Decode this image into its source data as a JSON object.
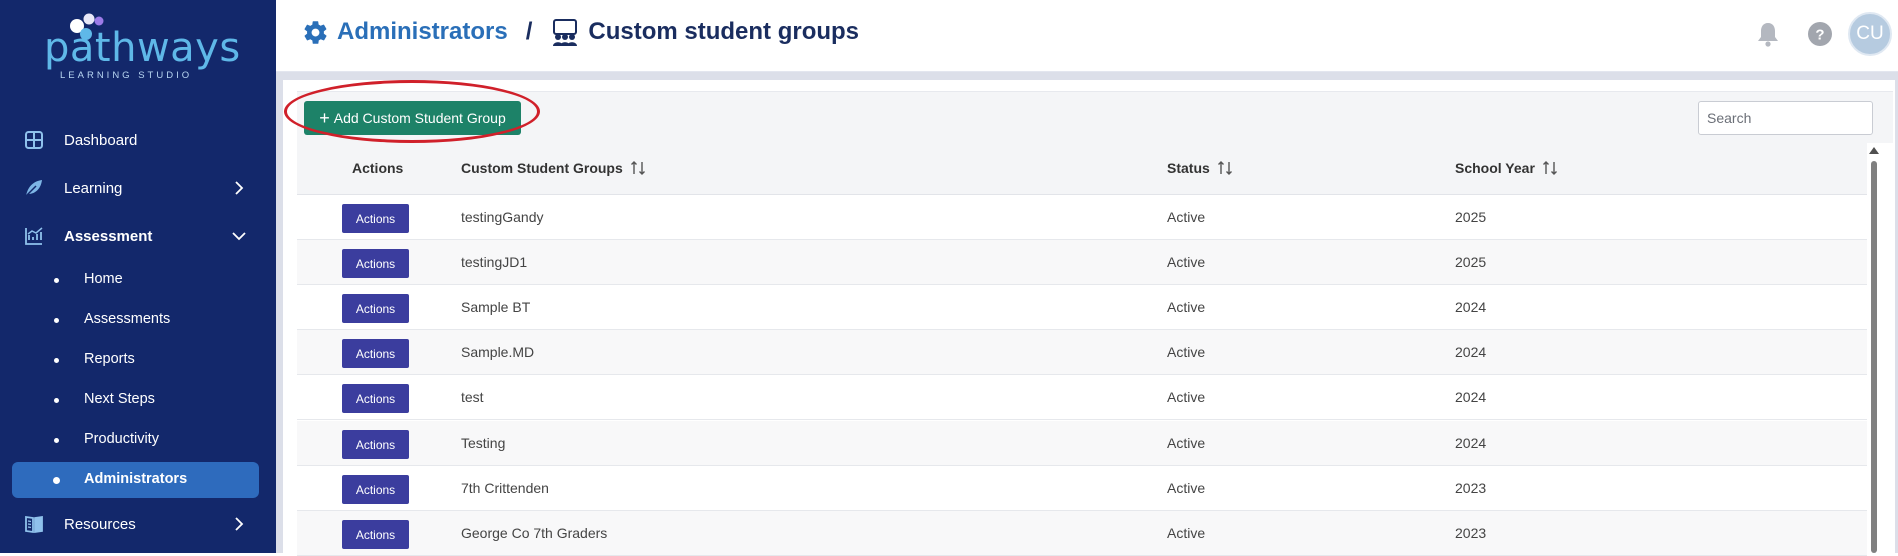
{
  "brand": {
    "logo_word": "pathways",
    "logo_sub": "LEARNING STUDIO"
  },
  "sidebar": {
    "items": [
      {
        "label": "Dashboard",
        "icon": "dashboard-grid-icon"
      },
      {
        "label": "Learning",
        "icon": "leaf-icon",
        "expandable": true,
        "expanded": false
      },
      {
        "label": "Assessment",
        "icon": "chart-line-icon",
        "expandable": true,
        "expanded": true
      },
      {
        "label": "Resources",
        "icon": "book-icon",
        "expandable": true,
        "expanded": false
      }
    ],
    "sub_items": [
      {
        "label": "Home",
        "active": false
      },
      {
        "label": "Assessments",
        "active": false
      },
      {
        "label": "Reports",
        "active": false
      },
      {
        "label": "Next Steps",
        "active": false
      },
      {
        "label": "Productivity",
        "active": false
      },
      {
        "label": "Administrators",
        "active": true
      }
    ]
  },
  "header": {
    "breadcrumb_parent": "Administrators",
    "breadcrumb_separator": "/",
    "breadcrumb_current": "Custom student groups",
    "avatar_initials": "CU",
    "icons": [
      "gear-icon",
      "student-group-icon",
      "bell-icon",
      "help-icon"
    ]
  },
  "toolbar": {
    "add_label": "Add Custom Student Group",
    "add_symbol": "+",
    "search_placeholder": "Search"
  },
  "table": {
    "columns": [
      "Actions",
      "Custom Student Groups",
      "Status",
      "School Year"
    ],
    "rows": [
      {
        "action": "Actions",
        "name": "testingGandy",
        "status": "Active",
        "year": "2025"
      },
      {
        "action": "Actions",
        "name": "testingJD1",
        "status": "Active",
        "year": "2025"
      },
      {
        "action": "Actions",
        "name": "Sample BT",
        "status": "Active",
        "year": "2024"
      },
      {
        "action": "Actions",
        "name": "Sample.MD",
        "status": "Active",
        "year": "2024"
      },
      {
        "action": "Actions",
        "name": "test",
        "status": "Active",
        "year": "2024"
      },
      {
        "action": "Actions",
        "name": "Testing",
        "status": "Active",
        "year": "2024"
      },
      {
        "action": "Actions",
        "name": "7th Crittenden",
        "status": "Active",
        "year": "2023"
      },
      {
        "action": "Actions",
        "name": "George Co 7th Graders",
        "status": "Active",
        "year": "2023"
      }
    ]
  },
  "colors": {
    "sidebar_bg": "#13286b",
    "active_item": "#2e6bbd",
    "add_button": "#1d8268",
    "action_button": "#3b3d9e",
    "highlight": "#d0202a",
    "breadcrumb_link": "#2a6fb8"
  }
}
